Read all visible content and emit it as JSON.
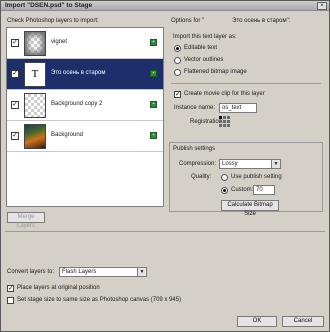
{
  "window": {
    "title": "Import \"DSEN.psd\" to Stage",
    "close_glyph": "×"
  },
  "layers": {
    "heading": "Check Photoshop layers to import:",
    "items": [
      {
        "name": "vignet",
        "checked": true,
        "thumb": "vignette"
      },
      {
        "name": "Это осень в старом",
        "checked": true,
        "thumb": "text",
        "thumb_text": "T",
        "selected": true
      },
      {
        "name": "Background copy 2",
        "checked": true,
        "thumb": "transparent"
      },
      {
        "name": "Background",
        "checked": true,
        "thumb": "photo"
      }
    ],
    "item_icon": "layer-type-icon",
    "merge_button": "Merge Layers"
  },
  "options": {
    "heading_prefix": "Options for \"",
    "heading_name": "Это осень в старом\":",
    "import_as_label": "Import this text layer as:",
    "import_as_options": [
      "Editable text",
      "Vector outlines",
      "Flattened bitmap image"
    ],
    "import_as_selected": 0,
    "movie_clip_label": "Create movie clip for this layer",
    "movie_clip_checked": true,
    "instance_name_label": "Instance name:",
    "instance_name_value": "os_text",
    "registration_label": "Registration:",
    "publish_heading": "Publish settings",
    "compression_label": "Compression:",
    "compression_value": "Lossy",
    "quality_label": "Quality:",
    "quality_options": [
      "Use publish setting",
      "Custom:"
    ],
    "quality_selected": 1,
    "custom_value": "70",
    "calc_button": "Calculate Bitmap Size"
  },
  "bottom": {
    "convert_label": "Convert layers to:",
    "convert_value": "Flash Layers",
    "place_label": "Place layers at original position",
    "place_checked": true,
    "stage_label": "Set stage size to same size as Photoshop canvas (709 x 945)",
    "stage_checked": false
  },
  "buttons": {
    "ok": "OK",
    "cancel": "Cancel"
  },
  "check_glyph": "✓"
}
